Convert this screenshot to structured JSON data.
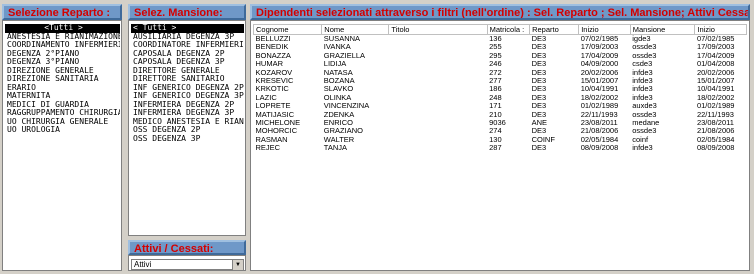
{
  "reparto": {
    "title": "Selezione Reparto :",
    "selected": "<Tutti >",
    "items": [
      "ANESTESIA E RIANIMAZIONE",
      "COORDINAMENTO INFERMIERIS",
      "DEGENZA 2°PIANO",
      "DEGENZA 3°PIANO",
      "DIREZIONE GENERALE",
      "DIREZIONE SANITARIA",
      "ERARIO",
      "MATERNITA",
      "MEDICI DI GUARDIA",
      "RAGGRUPPAMENTO CHIRURGIA",
      "UO CHIRURGIA GENERALE",
      "UO UROLOGIA"
    ]
  },
  "mansione": {
    "title": "Selez. Mansione:",
    "selected": "< Tutti >",
    "items": [
      "AUSILIARIA DEGENZA 3P",
      "COORDINATORE INFERMIERIS",
      "CAPOSALA DEGENZA 2P",
      "CAPOSALA DEGENZA 3P",
      "DIRETTORE GENERALE",
      "DIRETTORE SANITARIO",
      "INF GENERICO DEGENZA 2P",
      "INF GENERICO DEGENZA 3P",
      "INFERMIERA DEGENZA 2P",
      "INFERMIERA DEGENZA 3P",
      "MEDICO ANESTESIA E RIANIM",
      "OSS DEGENZA 2P",
      "OSS DEGENZA 3P"
    ]
  },
  "attivi": {
    "title": "Attivi / Cessati:",
    "value": "Attivi"
  },
  "dipendenti": {
    "title": "Dipendenti  selezionati attraverso i filtri (nell'ordine) :  Sel. Reparto ; Sel. Mansione; Attivi Cessati",
    "columns": [
      "Cognome",
      "Nome",
      "Titolo",
      "Matricola :",
      "Reparto",
      "Inizio",
      "Mansione",
      "Inizio"
    ],
    "rows": [
      [
        "BELLUZZI",
        "SUSANNA",
        "",
        "136",
        "DE3",
        "07/02/1985",
        "igde3",
        "07/02/1985"
      ],
      [
        "BENEDIK",
        "IVANKA",
        "",
        "255",
        "DE3",
        "17/09/2003",
        "ossde3",
        "17/09/2003"
      ],
      [
        "BONAZZA",
        "GRAZIELLA",
        "",
        "295",
        "DE3",
        "17/04/2009",
        "ossde3",
        "17/04/2009"
      ],
      [
        "HUMAR",
        "LIDIJA",
        "",
        "246",
        "DE3",
        "04/09/2000",
        "csde3",
        "01/04/2008"
      ],
      [
        "KOZAROV",
        "NATASA",
        "",
        "272",
        "DE3",
        "20/02/2006",
        "infde3",
        "20/02/2006"
      ],
      [
        "KRESEVIC",
        "BOZANA",
        "",
        "277",
        "DE3",
        "15/01/2007",
        "infde3",
        "15/01/2007"
      ],
      [
        "KRKOTIC",
        "SLAVKO",
        "",
        "186",
        "DE3",
        "10/04/1991",
        "infde3",
        "10/04/1991"
      ],
      [
        "LAZIC",
        "OLINKA",
        "",
        "248",
        "DE3",
        "18/02/2002",
        "infde3",
        "18/02/2002"
      ],
      [
        "LOPRETE",
        "VINCENZINA",
        "",
        "171",
        "DE3",
        "01/02/1989",
        "auxde3",
        "01/02/1989"
      ],
      [
        "MATIJASIC",
        "ZDENKA",
        "",
        "210",
        "DE3",
        "22/11/1993",
        "ossde3",
        "22/11/1993"
      ],
      [
        "MICHELONE",
        "ENRICO",
        "",
        "9036",
        "ANE",
        "23/08/2011",
        "medane",
        "23/08/2011"
      ],
      [
        "MOHORCIC",
        "GRAZIANO",
        "",
        "274",
        "DE3",
        "21/08/2006",
        "ossde3",
        "21/08/2006"
      ],
      [
        "RASMAN",
        "WALTER",
        "",
        "130",
        "COINF",
        "02/05/1984",
        "coinf",
        "02/05/1984"
      ],
      [
        "REJEC",
        "TANJA",
        "",
        "287",
        "DE3",
        "08/09/2008",
        "infde3",
        "08/09/2008"
      ]
    ]
  }
}
